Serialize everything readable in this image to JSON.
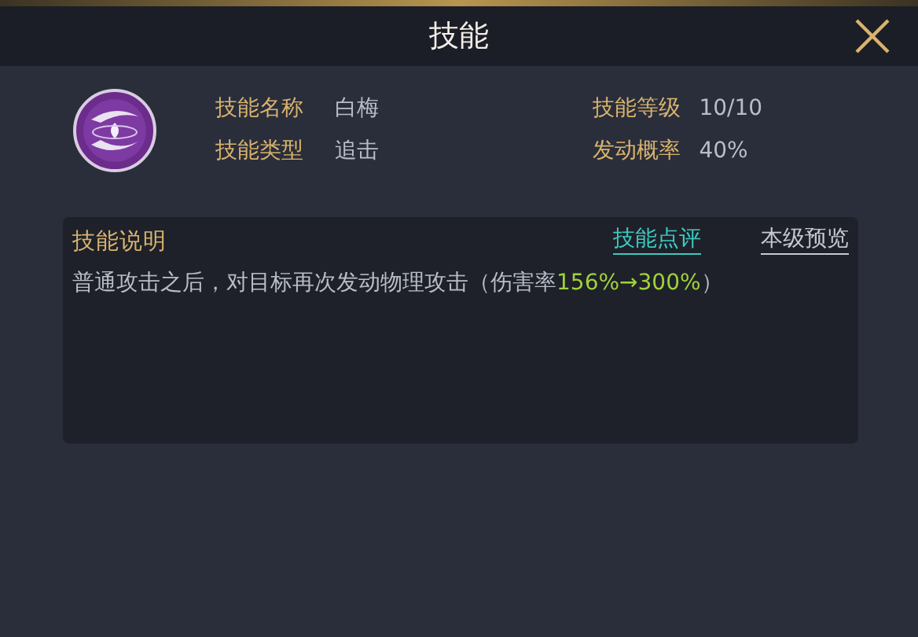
{
  "window": {
    "title": "技能"
  },
  "skill": {
    "fields": [
      {
        "label": "技能名称",
        "value": "白梅"
      },
      {
        "label": "技能等级",
        "value": "10/10"
      },
      {
        "label": "技能类型",
        "value": "追击"
      },
      {
        "label": "发动概率",
        "value": "40%"
      }
    ]
  },
  "description": {
    "title": "技能说明",
    "links": [
      {
        "label": "技能点评",
        "kind": "review"
      },
      {
        "label": "本级预览",
        "kind": "preview"
      }
    ],
    "segments": [
      {
        "text": "普通攻击之后，对目标再次发动物理攻击（伤害率",
        "kind": "plain"
      },
      {
        "text": "156%→300%",
        "kind": "highlight"
      },
      {
        "text": "）",
        "kind": "plain"
      }
    ]
  }
}
